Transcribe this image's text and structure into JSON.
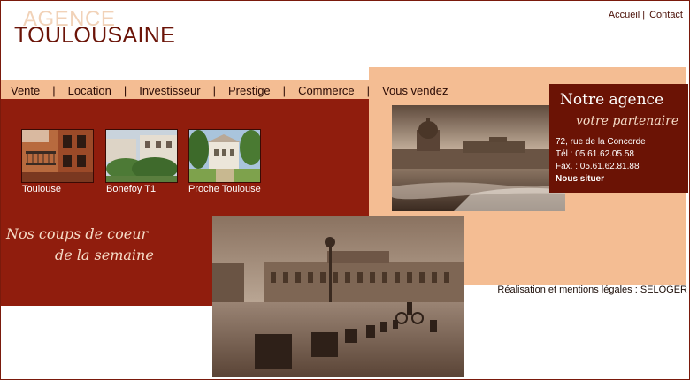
{
  "header": {
    "logo_line1": "AGENCE",
    "logo_line2": "TOULOUSAINE",
    "links": [
      "Accueil",
      "Contact"
    ],
    "link_sep": "|"
  },
  "nav": {
    "items": [
      "Vente",
      "Location",
      "Investisseur",
      "Prestige",
      "Commerce",
      "Vous vendez"
    ],
    "sep": "|"
  },
  "properties": [
    {
      "label": "Toulouse",
      "image": "balcony-building-photo"
    },
    {
      "label": "Bonefoy T1",
      "image": "house-garden-photo"
    },
    {
      "label": "Proche Toulouse",
      "image": "villa-trees-photo"
    }
  ],
  "promo": {
    "line1": "Nos coups de coeur",
    "line2": "de la semaine"
  },
  "agence": {
    "title": "Notre agence",
    "subtitle": "votre partenaire",
    "address": "72, rue de la Concorde",
    "tel": "Tél : 05.61.62.05.58",
    "fax": "Fax. : 05.61.62.81.88",
    "locate_link": "Nous situer"
  },
  "footer": {
    "credits": "Réalisation et mentions légales : SELOGER"
  },
  "colors": {
    "brand_dark": "#6b1408",
    "red_block": "#901d0d",
    "peach": "#f4bd93"
  }
}
